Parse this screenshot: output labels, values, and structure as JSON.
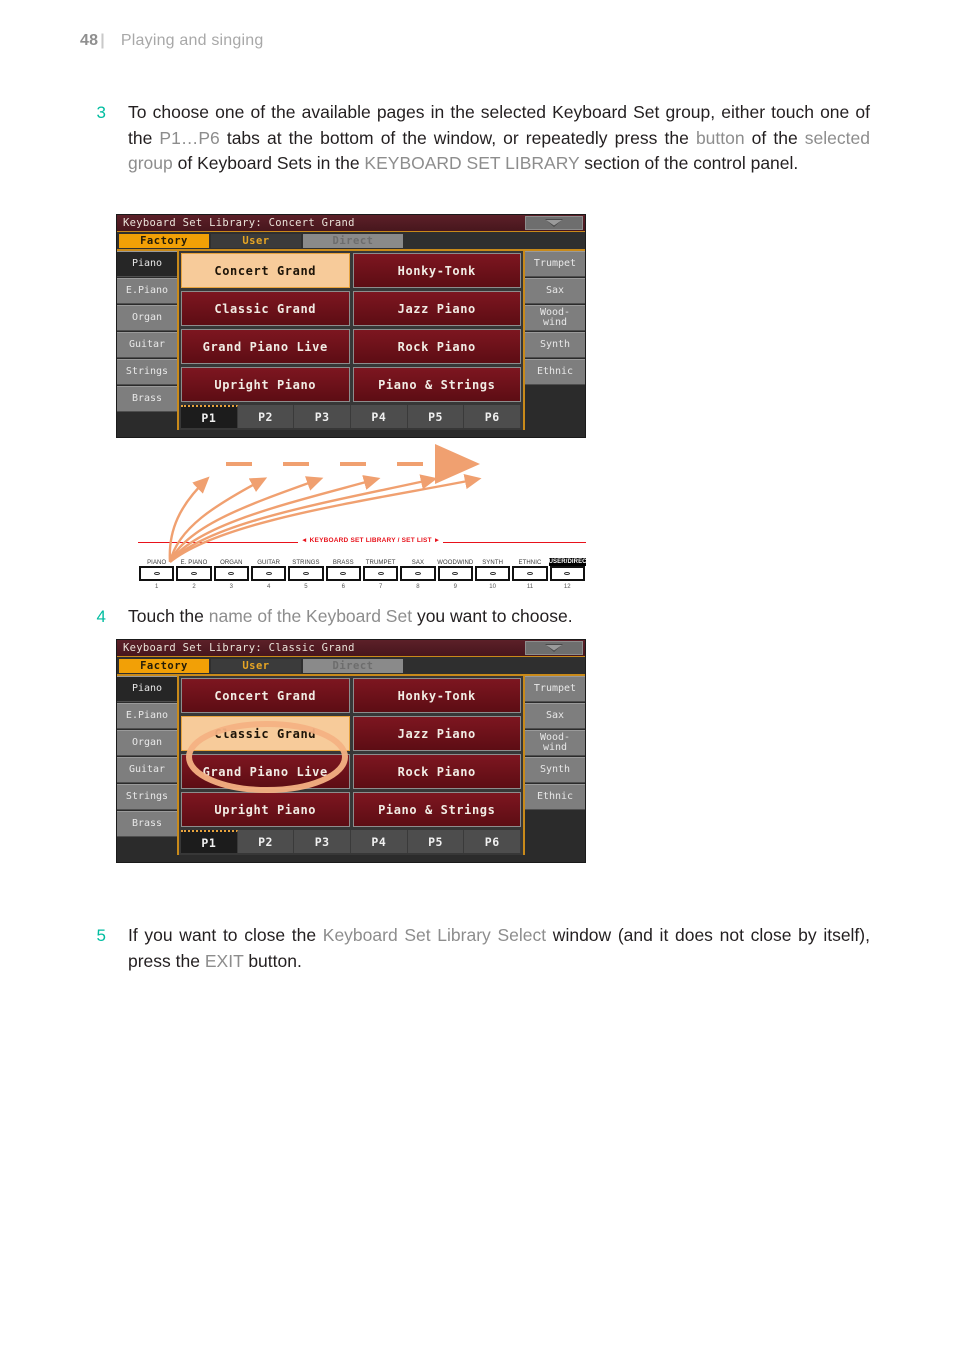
{
  "running_head": {
    "page_number": "48",
    "separator": "|",
    "chapter": "Playing and singing"
  },
  "steps": [
    {
      "number": "3",
      "segments": [
        {
          "text": "To choose one of the available pages in the selected Keyboard Set group, either touch one of the ",
          "style": "normal"
        },
        {
          "text": "P1…P6",
          "style": "gray"
        },
        {
          "text": " tabs at the bottom of the window, or repeatedly press the ",
          "style": "normal"
        },
        {
          "text": "button",
          "style": "gray"
        },
        {
          "text": " of the ",
          "style": "normal"
        },
        {
          "text": "selected group",
          "style": "gray"
        },
        {
          "text": " of Keyboard Sets in the ",
          "style": "normal"
        },
        {
          "text": "KEYBOARD SET LIBRARY",
          "style": "gray"
        },
        {
          "text": " section of the control panel.",
          "style": "normal"
        }
      ]
    },
    {
      "number": "4",
      "segments": [
        {
          "text": "Touch the ",
          "style": "normal"
        },
        {
          "text": "name of the Keyboard Set",
          "style": "gray"
        },
        {
          "text": " you want to choose.",
          "style": "normal"
        }
      ]
    },
    {
      "number": "5",
      "segments": [
        {
          "text": "If you want to close the ",
          "style": "normal"
        },
        {
          "text": "Keyboard Set Library Select",
          "style": "gray"
        },
        {
          "text": " window (and it does not close by itself), press the ",
          "style": "normal"
        },
        {
          "text": "EXIT",
          "style": "gray"
        },
        {
          "text": " button.",
          "style": "normal"
        }
      ]
    }
  ],
  "panel_one": {
    "title": "Keyboard Set Library: Concert Grand",
    "dropdown_icon": "chevron-down-icon",
    "tabs": [
      {
        "label": "Factory",
        "state": "selected"
      },
      {
        "label": "User",
        "state": "normal"
      },
      {
        "label": "Direct",
        "state": "disabled"
      }
    ],
    "left_groups": [
      {
        "label": "Piano",
        "selected": true
      },
      {
        "label": "E.Piano",
        "selected": false
      },
      {
        "label": "Organ",
        "selected": false
      },
      {
        "label": "Guitar",
        "selected": false
      },
      {
        "label": "Strings",
        "selected": false
      },
      {
        "label": "Brass",
        "selected": false
      }
    ],
    "right_groups": [
      {
        "label": "Trumpet",
        "selected": false
      },
      {
        "label": "Sax",
        "selected": false
      },
      {
        "label": "Wood-\nwind",
        "selected": false
      },
      {
        "label": "Synth",
        "selected": false
      },
      {
        "label": "Ethnic",
        "selected": false
      }
    ],
    "keyboard_sets": [
      {
        "label": "Concert Grand",
        "selected": true
      },
      {
        "label": "Honky-Tonk",
        "selected": false
      },
      {
        "label": "Classic Grand",
        "selected": false
      },
      {
        "label": "Jazz Piano",
        "selected": false
      },
      {
        "label": "Grand Piano Live",
        "selected": false
      },
      {
        "label": "Rock Piano",
        "selected": false
      },
      {
        "label": "Upright Piano",
        "selected": false
      },
      {
        "label": "Piano & Strings",
        "selected": false
      }
    ],
    "page_tabs": [
      {
        "label": "P1",
        "selected": true
      },
      {
        "label": "P2",
        "selected": false
      },
      {
        "label": "P3",
        "selected": false
      },
      {
        "label": "P4",
        "selected": false
      },
      {
        "label": "P5",
        "selected": false
      },
      {
        "label": "P6",
        "selected": false
      }
    ]
  },
  "panel_two": {
    "title": "Keyboard Set Library: Classic Grand",
    "dropdown_icon": "chevron-down-icon",
    "tabs": [
      {
        "label": "Factory",
        "state": "selected"
      },
      {
        "label": "User",
        "state": "normal"
      },
      {
        "label": "Direct",
        "state": "disabled"
      }
    ],
    "left_groups": [
      {
        "label": "Piano",
        "selected": true
      },
      {
        "label": "E.Piano",
        "selected": false
      },
      {
        "label": "Organ",
        "selected": false
      },
      {
        "label": "Guitar",
        "selected": false
      },
      {
        "label": "Strings",
        "selected": false
      },
      {
        "label": "Brass",
        "selected": false
      }
    ],
    "right_groups": [
      {
        "label": "Trumpet",
        "selected": false
      },
      {
        "label": "Sax",
        "selected": false
      },
      {
        "label": "Wood-\nwind",
        "selected": false
      },
      {
        "label": "Synth",
        "selected": false
      },
      {
        "label": "Ethnic",
        "selected": false
      }
    ],
    "keyboard_sets": [
      {
        "label": "Concert Grand",
        "selected": false
      },
      {
        "label": "Honky-Tonk",
        "selected": false
      },
      {
        "label": "Classic Grand",
        "selected": true
      },
      {
        "label": "Jazz Piano",
        "selected": false
      },
      {
        "label": "Grand Piano Live",
        "selected": false
      },
      {
        "label": "Rock Piano",
        "selected": false
      },
      {
        "label": "Upright Piano",
        "selected": false
      },
      {
        "label": "Piano & Strings",
        "selected": false
      }
    ],
    "page_tabs": [
      {
        "label": "P1",
        "selected": true
      },
      {
        "label": "P2",
        "selected": false
      },
      {
        "label": "P3",
        "selected": false
      },
      {
        "label": "P4",
        "selected": false
      },
      {
        "label": "P5",
        "selected": false
      },
      {
        "label": "P6",
        "selected": false
      }
    ]
  },
  "control_panel": {
    "section_label": "◄ KEYBOARD SET LIBRARY / SET LIST ►",
    "buttons": [
      {
        "name": "PIANO",
        "index": "1",
        "highlighted": false
      },
      {
        "name": "E. PIANO",
        "index": "2",
        "highlighted": false
      },
      {
        "name": "ORGAN",
        "index": "3",
        "highlighted": false
      },
      {
        "name": "GUITAR",
        "index": "4",
        "highlighted": false
      },
      {
        "name": "STRINGS",
        "index": "5",
        "highlighted": false
      },
      {
        "name": "BRASS",
        "index": "6",
        "highlighted": false
      },
      {
        "name": "TRUMPET",
        "index": "7",
        "highlighted": false
      },
      {
        "name": "SAX",
        "index": "8",
        "highlighted": false
      },
      {
        "name": "WOODWIND",
        "index": "9",
        "highlighted": false
      },
      {
        "name": "SYNTH",
        "index": "10",
        "highlighted": false
      },
      {
        "name": "ETHNIC",
        "index": "11",
        "highlighted": false
      },
      {
        "name": "USER/DIRECT",
        "index": "12",
        "highlighted": true
      }
    ]
  },
  "colors": {
    "step_number": "#00bda0",
    "emphasis_gray": "#8d8d8d",
    "accent_orange": "#f2a006",
    "annotation_orange": "#f2a878",
    "panel_red": "#7d1620",
    "control_panel_red": "#e8121b"
  }
}
